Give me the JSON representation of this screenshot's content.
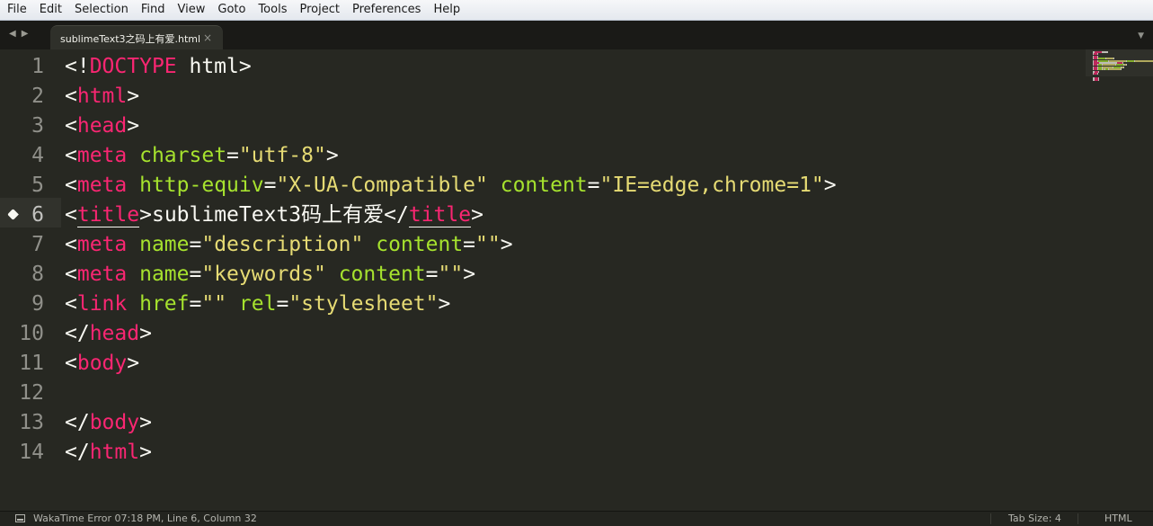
{
  "menu": [
    "File",
    "Edit",
    "Selection",
    "Find",
    "View",
    "Goto",
    "Tools",
    "Project",
    "Preferences",
    "Help"
  ],
  "tab": {
    "title": "sublimeText3之码上有爱.html",
    "close": "×"
  },
  "nav": {
    "back": "◀",
    "forward": "▶",
    "tab_menu": "▼"
  },
  "editor": {
    "active_line": 6,
    "lines": [
      {
        "n": "1",
        "tokens": [
          [
            "p",
            "<!"
          ],
          [
            "tag",
            "DOCTYPE"
          ],
          [
            "p",
            " html>"
          ]
        ]
      },
      {
        "n": "2",
        "tokens": [
          [
            "p",
            "<"
          ],
          [
            "tag",
            "html"
          ],
          [
            "p",
            ">"
          ]
        ]
      },
      {
        "n": "3",
        "tokens": [
          [
            "p",
            "<"
          ],
          [
            "tag",
            "head"
          ],
          [
            "p",
            ">"
          ]
        ]
      },
      {
        "n": "4",
        "tokens": [
          [
            "p",
            "<"
          ],
          [
            "tag",
            "meta"
          ],
          [
            "p",
            " "
          ],
          [
            "attr",
            "charset"
          ],
          [
            "p",
            "="
          ],
          [
            "str",
            "\"utf-8\""
          ],
          [
            "p",
            ">"
          ]
        ]
      },
      {
        "n": "5",
        "tokens": [
          [
            "p",
            "<"
          ],
          [
            "tag",
            "meta"
          ],
          [
            "p",
            " "
          ],
          [
            "attr",
            "http-equiv"
          ],
          [
            "p",
            "="
          ],
          [
            "str",
            "\"X-UA-Compatible\""
          ],
          [
            "p",
            " "
          ],
          [
            "attr",
            "content"
          ],
          [
            "p",
            "="
          ],
          [
            "str",
            "\"IE=edge,chrome=1\""
          ],
          [
            "p",
            ">"
          ]
        ]
      },
      {
        "n": "6",
        "tokens": [
          [
            "p",
            "<"
          ],
          [
            "tagm",
            "title"
          ],
          [
            "p",
            ">"
          ],
          [
            "text",
            "sublimeText3"
          ],
          [
            "cjk",
            "码上有爱"
          ],
          [
            "p",
            "</"
          ],
          [
            "tagm",
            "title"
          ],
          [
            "p",
            ">"
          ]
        ]
      },
      {
        "n": "7",
        "tokens": [
          [
            "p",
            "<"
          ],
          [
            "tag",
            "meta"
          ],
          [
            "p",
            " "
          ],
          [
            "attr",
            "name"
          ],
          [
            "p",
            "="
          ],
          [
            "str",
            "\"description\""
          ],
          [
            "p",
            " "
          ],
          [
            "attr",
            "content"
          ],
          [
            "p",
            "="
          ],
          [
            "str",
            "\"\""
          ],
          [
            "p",
            ">"
          ]
        ]
      },
      {
        "n": "8",
        "tokens": [
          [
            "p",
            "<"
          ],
          [
            "tag",
            "meta"
          ],
          [
            "p",
            " "
          ],
          [
            "attr",
            "name"
          ],
          [
            "p",
            "="
          ],
          [
            "str",
            "\"keywords\""
          ],
          [
            "p",
            " "
          ],
          [
            "attr",
            "content"
          ],
          [
            "p",
            "="
          ],
          [
            "str",
            "\"\""
          ],
          [
            "p",
            ">"
          ]
        ]
      },
      {
        "n": "9",
        "tokens": [
          [
            "p",
            "<"
          ],
          [
            "tag",
            "link"
          ],
          [
            "p",
            " "
          ],
          [
            "attr",
            "href"
          ],
          [
            "p",
            "="
          ],
          [
            "str",
            "\"\""
          ],
          [
            "p",
            " "
          ],
          [
            "attr",
            "rel"
          ],
          [
            "p",
            "="
          ],
          [
            "str",
            "\"stylesheet\""
          ],
          [
            "p",
            ">"
          ]
        ]
      },
      {
        "n": "10",
        "tokens": [
          [
            "p",
            "</"
          ],
          [
            "tag",
            "head"
          ],
          [
            "p",
            ">"
          ]
        ]
      },
      {
        "n": "11",
        "tokens": [
          [
            "p",
            "<"
          ],
          [
            "tag",
            "body"
          ],
          [
            "p",
            ">"
          ]
        ]
      },
      {
        "n": "12",
        "tokens": []
      },
      {
        "n": "13",
        "tokens": [
          [
            "p",
            "</"
          ],
          [
            "tag",
            "body"
          ],
          [
            "p",
            ">"
          ]
        ]
      },
      {
        "n": "14",
        "tokens": [
          [
            "p",
            "</"
          ],
          [
            "tag",
            "html"
          ],
          [
            "p",
            ">"
          ]
        ]
      }
    ]
  },
  "status": {
    "message": "WakaTime Error 07:18 PM, Line 6, Column 32",
    "tab_size": "Tab Size: 4",
    "syntax": "HTML"
  },
  "colors": {
    "background": "#272822",
    "tag": "#f92672",
    "attribute": "#a6e22e",
    "string": "#e6db74",
    "text": "#f8f8f2",
    "line_number": "#90908a"
  }
}
